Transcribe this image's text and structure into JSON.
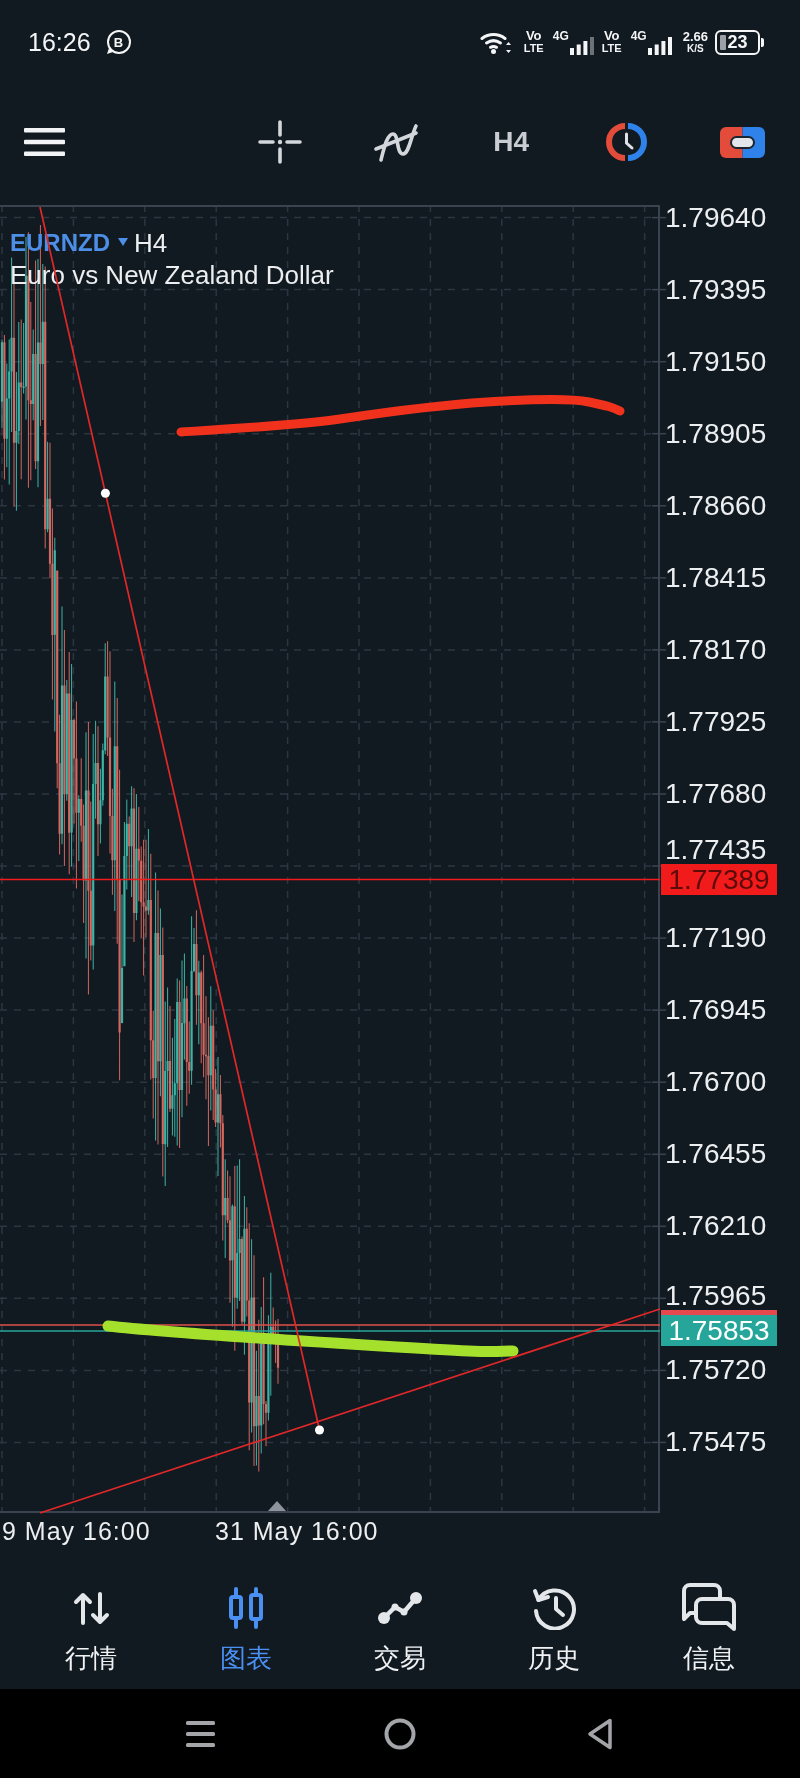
{
  "status_bar": {
    "time": "16:26",
    "notification_badge": "B",
    "networks": [
      {
        "volte_top": "Vo",
        "volte_bottom": "LTE",
        "type": "4G"
      },
      {
        "volte_top": "Vo",
        "volte_bottom": "LTE",
        "type": "4G"
      }
    ],
    "speed_value": "2.66",
    "speed_unit": "K/S",
    "battery": "23"
  },
  "toolbar": {
    "timeframe": "H4"
  },
  "chart": {
    "symbol": "EURNZD",
    "timeframe": "H4",
    "description": "Euro vs New Zealand Dollar",
    "price_labels": [
      "1.79640",
      "1.79395",
      "1.79150",
      "1.78905",
      "1.78660",
      "1.78415",
      "1.78170",
      "1.77925",
      "1.77680",
      "1.77435",
      "1.77190",
      "1.76945",
      "1.76700",
      "1.76455",
      "1.76210",
      "1.75965",
      "1.75720",
      "1.75475"
    ],
    "price_tags": [
      {
        "text": "1.77389",
        "color": "#f21b1b"
      },
      {
        "text": "1.75853",
        "color": "#26a69a"
      }
    ],
    "date_labels": [
      "9 May 16:00",
      "31 May 16:00"
    ]
  },
  "nav": {
    "items": [
      {
        "label": "行情",
        "selected": false
      },
      {
        "label": "图表",
        "selected": true
      },
      {
        "label": "交易",
        "selected": false
      },
      {
        "label": "历史",
        "selected": false
      },
      {
        "label": "信息",
        "selected": false
      }
    ]
  }
}
